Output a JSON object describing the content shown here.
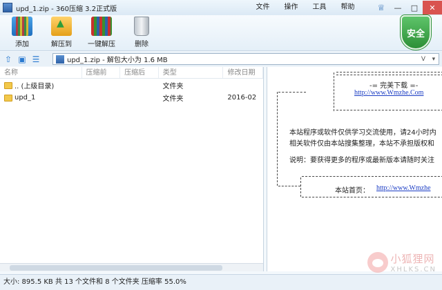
{
  "window": {
    "title": "upd_1.zip - 360压缩 3.2正式版",
    "menus": [
      "文件",
      "操作",
      "工具",
      "帮助"
    ]
  },
  "toolbar": {
    "buttons": [
      {
        "label": "添加",
        "icon": "add-archive-icon"
      },
      {
        "label": "解压到",
        "icon": "extract-to-icon"
      },
      {
        "label": "一键解压",
        "icon": "one-click-extract-icon"
      },
      {
        "label": "删除",
        "icon": "trash-icon"
      }
    ],
    "security_badge": "安全"
  },
  "address": {
    "text": "upd_1.zip - 解包大小为 1.6 MB",
    "dropdown_label": "V"
  },
  "file_list": {
    "columns": [
      "名称",
      "压缩前",
      "压缩后",
      "类型",
      "修改日期"
    ],
    "rows": [
      {
        "name": ".. (上级目录)",
        "type": "文件夹",
        "date": ""
      },
      {
        "name": "upd_1",
        "type": "文件夹",
        "date": "2016-02"
      }
    ]
  },
  "preview": {
    "header": "-= 完美下载 =-",
    "site_url": "http://www.Wmzhe.Com",
    "para1_line1": "本站程序或软件仅供学习交流使用，请24小时内",
    "para1_line2": "相关软件仅由本站搜集整理，本站不承担版权和",
    "para2": "说明：要获得更多的程序或最新版本请随时关注",
    "home_label": "本站首页：",
    "home_url": "http://www.Wmzhe"
  },
  "status": {
    "text": "大小: 895.5 KB 共 13 个文件和 8 个文件夹 压缩率 55.0%"
  },
  "watermark": {
    "cn": "小狐狸网",
    "en": "XHLKS.CN"
  }
}
